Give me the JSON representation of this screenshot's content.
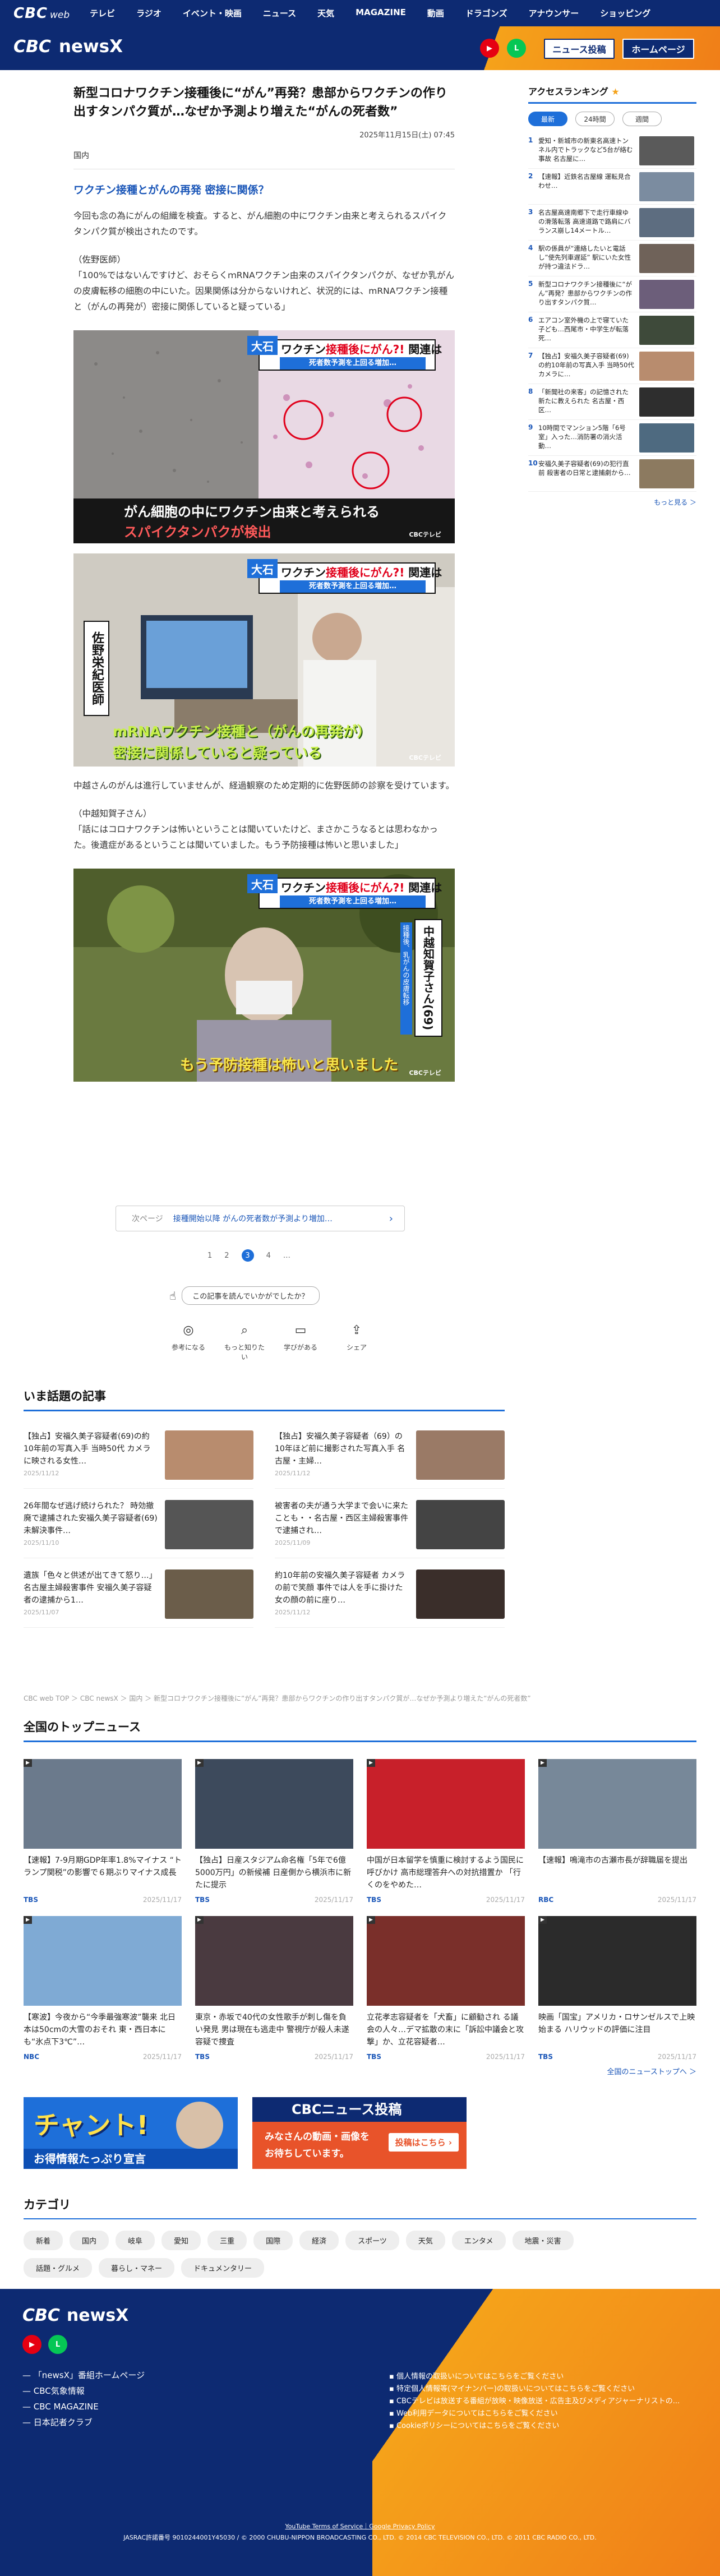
{
  "topbar": {
    "logo": "CBC",
    "logo_sub": "web",
    "nav": [
      "テレビ",
      "ラジオ",
      "イベント・映画",
      "ニュース",
      "天気",
      "MAGAZINE",
      "動画",
      "ドラゴンズ",
      "アナウンサー",
      "ショッピング"
    ]
  },
  "header": {
    "brand_cbc": "CBC",
    "brand_news": "newsX",
    "social": [
      "YT",
      "LINE"
    ],
    "post_button": "ニュース投稿",
    "home_button": "ホームページ"
  },
  "article": {
    "title": "新型コロナワクチン接種後に“がん”再発？患部からワクチンの作り出すタンパク質が…なぜか予測より増えた“がんの死者数”",
    "date": "2025年11月15日(土) 07:45",
    "category": "国内",
    "subhead": "ワクチン接種とがんの再発 密接に関係？",
    "paragraphs": [
      "今回も念の為にがんの組織を検査。すると、がん細胞の中にワクチン由来と考えられるスパイクタンパク質が検出されたのです。",
      "（佐野医師）\n「100%ではないんですけど、おそらくｍRNAワクチン由来のスパイクタンパクが、なぜか乳がんの皮膚転移の細胞の中にいた。因果関係は分からないけれど、状況的には、mRNAワクチン接種と（がんの再発が）密接に関係していると疑っている」",
      "中越さんのがんは進行していませんが、経過観察のため定期的に佐野医師の診察を受けています。",
      "（中越知賀子さん）\n「話にはコロナワクチンは怖いということは聞いていたけど、まさかこうなるとは思わなかった。後遺症があるということは聞いていました。もう予防接種は怖いと思いました」"
    ],
    "photos": [
      {
        "badge": "大石",
        "headline_black": "ワクチン",
        "headline_red": "接種後にがん?!",
        "headline_tail": "関連は",
        "sub": "死者数予測を上回る増加…",
        "caption_white": "がん細胞の中にワクチン由来と考えられる",
        "caption_red": "スパイクタンパクが検出",
        "credit": "CBCテレビ"
      },
      {
        "badge": "大石",
        "headline_black": "ワクチン",
        "headline_red": "接種後にがん?!",
        "headline_tail": "関連は",
        "sub": "死者数予測を上回る増加…",
        "name_tag": "佐野栄紀医師",
        "caption_line1": "mRNAワクチン接種と（がんの再発が）",
        "caption_line2": "密接に関係していると疑っている",
        "credit": "CBCテレビ"
      },
      {
        "badge": "大石",
        "headline_black": "ワクチン",
        "headline_red": "接種後にがん?!",
        "headline_tail": "関連は",
        "sub": "死者数予測を上回る増加…",
        "name_tag": "中越知賀子さん(69)",
        "name_sub": "接種後、乳がんの皮膚転移",
        "caption_white": "もう予防接種は怖いと思いました",
        "credit": "CBCテレビ"
      }
    ],
    "pager": {
      "label": "次ページ",
      "text": "接種開始以降 がんの死者数が予測より増加…"
    },
    "pages": [
      "1",
      "2",
      "3",
      "4",
      "…"
    ],
    "current_page": "3",
    "reaction_question": "この記事を読んでいかがでしたか？",
    "reactions": [
      "参考になる",
      "もっと知りたい",
      "学びがある",
      "シェア"
    ]
  },
  "trending": {
    "heading": "いま話題の記事",
    "items": [
      {
        "title": "【独占】安福久美子容疑者(69)の約10年前の写真入手 当時50代 カメラに映される女性…",
        "date": "2025/11/12",
        "color": "#b88c6e"
      },
      {
        "title": "【独占】安福久美子容疑者（69）の10年ほど前に撮影された写真入手 名古屋・主婦…",
        "date": "2025/11/12",
        "color": "#9a7a66"
      },
      {
        "title": "26年間なぜ逃げ続けられた？ 時効撤廃で逮捕された安福久美子容疑者(69) 未解決事件…",
        "date": "2025/11/10",
        "color": "#555"
      },
      {
        "title": "被害者の夫が通う大学まで会いに来たことも・・名古屋・西区主婦殺害事件で逮捕され…",
        "date": "2025/11/09",
        "color": "#444"
      },
      {
        "title": "遺族「色々と供述が出てきて怒り…」名古屋主婦殺害事件 安福久美子容疑者の逮捕から1…",
        "date": "2025/11/07",
        "color": "#6b5d4a"
      },
      {
        "title": "約10年前の安福久美子容疑者 カメラの前で笑顔 事件では人を手に掛けた女の顔の前に座り…",
        "date": "2025/11/12",
        "color": "#3a2e2a"
      }
    ]
  },
  "breadcrumbs": "CBC web TOP ＞ CBC newsX ＞ 国内 ＞ 新型コロナワクチン接種後に“がん”再発？患部からワクチンの作り出すタンパク質が…なぜか予測より増えた“がんの死者数”",
  "national": {
    "heading": "全国のトップニュース",
    "more": "全国のニューストップへ ＞",
    "items": [
      {
        "title": "【速報】7-9月期GDP年率1.8%マイナス “トランプ関税”の影響で６期ぶりマイナス成長",
        "src": "TBS",
        "date": "2025/11/17",
        "color": "#6b7a8c"
      },
      {
        "title": "【独占】日産スタジアム命名権「5年で6億5000万円」の新候補 日産側から横浜市に新たに提示",
        "src": "TBS",
        "date": "2025/11/17",
        "color": "#3d4a5c"
      },
      {
        "title": "中国が日本留学を慎重に検討するよう国民に呼びかけ 高市総理答弁への対抗措置か 「行くのをやめた…",
        "src": "TBS",
        "date": "2025/11/17",
        "color": "#c8202a"
      },
      {
        "title": "【速報】鳴滝市の古瀬市長が辞職届を提出",
        "src": "RBC",
        "date": "2025/11/17",
        "color": "#778899"
      },
      {
        "title": "【寒波】今夜から“今季最強寒波”襲来 北日本は50cmの大雪のおそれ 東・西日本にも“氷点下3℃”…",
        "src": "NBC",
        "date": "2025/11/17",
        "color": "#7faad4"
      },
      {
        "title": "東京・赤坂で40代の女性歌手が刺し傷を負い発見 男は現在も逃走中 警視庁が殺人未遂容疑で捜査",
        "src": "TBS",
        "date": "2025/11/17",
        "color": "#4a3a40"
      },
      {
        "title": "立花孝志容疑者を「犬畜」に顧勧され る議会の人々…デマ拡散の末に「訴訟中議会と攻撃」か、立花容疑者…",
        "src": "TBS",
        "date": "2025/11/17",
        "color": "#7a2f2a"
      },
      {
        "title": "映画「国宝」アメリカ・ロサンゼルスで上映始まる ハリウッドの評価に注目",
        "src": "TBS",
        "date": "2025/11/17",
        "color": "#2b2b2b"
      }
    ]
  },
  "banners": [
    {
      "name": "chant",
      "text1": "チャント!",
      "text2": "お得情報たっぷり宣言"
    },
    {
      "name": "post",
      "text1": "CBCニュース投稿",
      "text2": "みなさんの動画・画像を",
      "text3": "お待ちしています。",
      "btn": "投稿はこちら ›"
    }
  ],
  "categories": {
    "heading": "カテゴリ",
    "items": [
      "新着",
      "国内",
      "岐阜",
      "愛知",
      "三重",
      "国際",
      "経済",
      "スポーツ",
      "天気",
      "エンタメ",
      "地震・災害",
      "話題・グルメ",
      "暮らし・マネー",
      "ドキュメンタリー"
    ]
  },
  "sidebar": {
    "heading": "アクセスランキング",
    "tabs": [
      "最新",
      "24時間",
      "週間"
    ],
    "active_tab": "最新",
    "items": [
      {
        "n": "1",
        "title": "愛知・新城市の新東名高速トンネル内でトラックなど5台が絡む事故 名古屋に…",
        "color": "#5a5a5a"
      },
      {
        "n": "2",
        "title": "【速報】近鉄名古屋線 運転見合わせ…",
        "color": "#7b8ca0"
      },
      {
        "n": "3",
        "title": "名古屋高速南郷下で走行車線ゆの滑落転落 高速道路で路肩にバランス崩し14メートル…",
        "color": "#5d6d80"
      },
      {
        "n": "4",
        "title": "駅の係員が“連絡したいと電話し”使先列車遅延” 駅にいた女性が持つ違法ドラ…",
        "color": "#6f6259"
      },
      {
        "n": "5",
        "title": "新型コロナワクチン接種後に“がん”再発？患部からワクチンの作り出すタンパク質…",
        "color": "#6c5e7a"
      },
      {
        "n": "6",
        "title": "エアコン室外機の上で寝ていた子ども…西尾市・中学生が転落死…",
        "color": "#3e4a3a"
      },
      {
        "n": "7",
        "title": "【独占】安福久美子容疑者(69)の約10年前の写真入手 当時50代 カメラに…",
        "color": "#b88c6e"
      },
      {
        "n": "8",
        "title": "「新聞社の来客」の記憶された新たに教えられた 名古屋・西区…",
        "color": "#2e2e2e"
      },
      {
        "n": "9",
        "title": "10時間でマンション5階「6号室」入った…消防署の消火活動…",
        "color": "#4e6a80"
      },
      {
        "n": "10",
        "title": "安福久美子容疑者(69)の犯行直前 殺害者の日常と逮捕劇から…",
        "color": "#8c7a60"
      }
    ],
    "more": "もっと見る ＞"
  },
  "footer": {
    "brand_cbc": "CBC",
    "brand_news": "newsX",
    "links": [
      "「newsX」番組ホームページ",
      "CBC気象情報",
      "CBC MAGAZINE",
      "日本記者クラブ"
    ],
    "right_links": [
      "個人情報の取扱いについてはこちらをご覧ください",
      "特定個人情報等(マイナンバー)の取扱いについてはこちらをご覧ください",
      "CBCテレビは放送する番組が放映・映像放送・広告主及びメディアジャーナリストの...",
      "Web利用データについてはこちらをご覧ください",
      "Cookieポリシーについてはこちらをご覧ください"
    ],
    "terms": "YouTube Terms of Service｜Google Privacy Policy",
    "copyright": "JASRAC許諾番号 9010244001Y45030 / © 2000 CHUBU-NIPPON BROADCASTING CO., LTD. © 2014 CBC TELEVISION CO., LTD. © 2011 CBC RADIO CO., LTD."
  }
}
